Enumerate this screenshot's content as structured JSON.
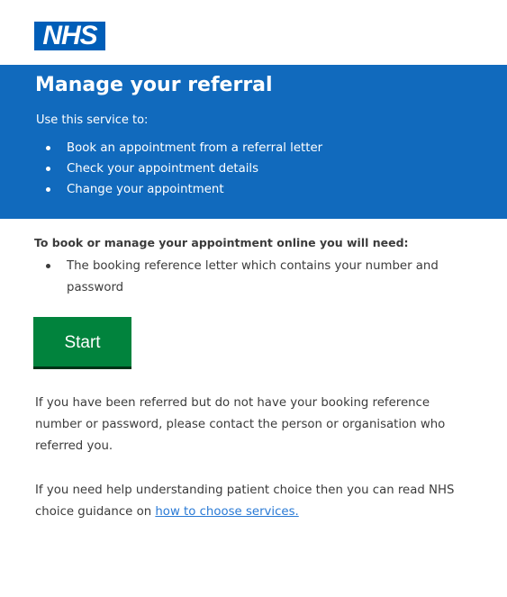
{
  "header": {
    "logo_text": "NHS",
    "brand_color": "#005eb8"
  },
  "hero": {
    "title": "Manage your referral",
    "intro": "Use this service to:",
    "items": [
      "Book an appointment from a referral letter",
      "Check your appointment details",
      "Change your appointment"
    ],
    "color": "#116abd"
  },
  "main": {
    "need_heading": "To book or manage your appointment online you will need:",
    "need_items": [
      "The booking reference letter which contains your number and password"
    ],
    "start_label": "Start",
    "start_color": "#01833d",
    "para1": "If you have been referred but do not have your booking reference number or password, please contact the person or organisation who referred you.",
    "para2_prefix": "If you need help understanding patient choice then you can read NHS choice guidance on ",
    "para2_link": "how to choose services."
  }
}
